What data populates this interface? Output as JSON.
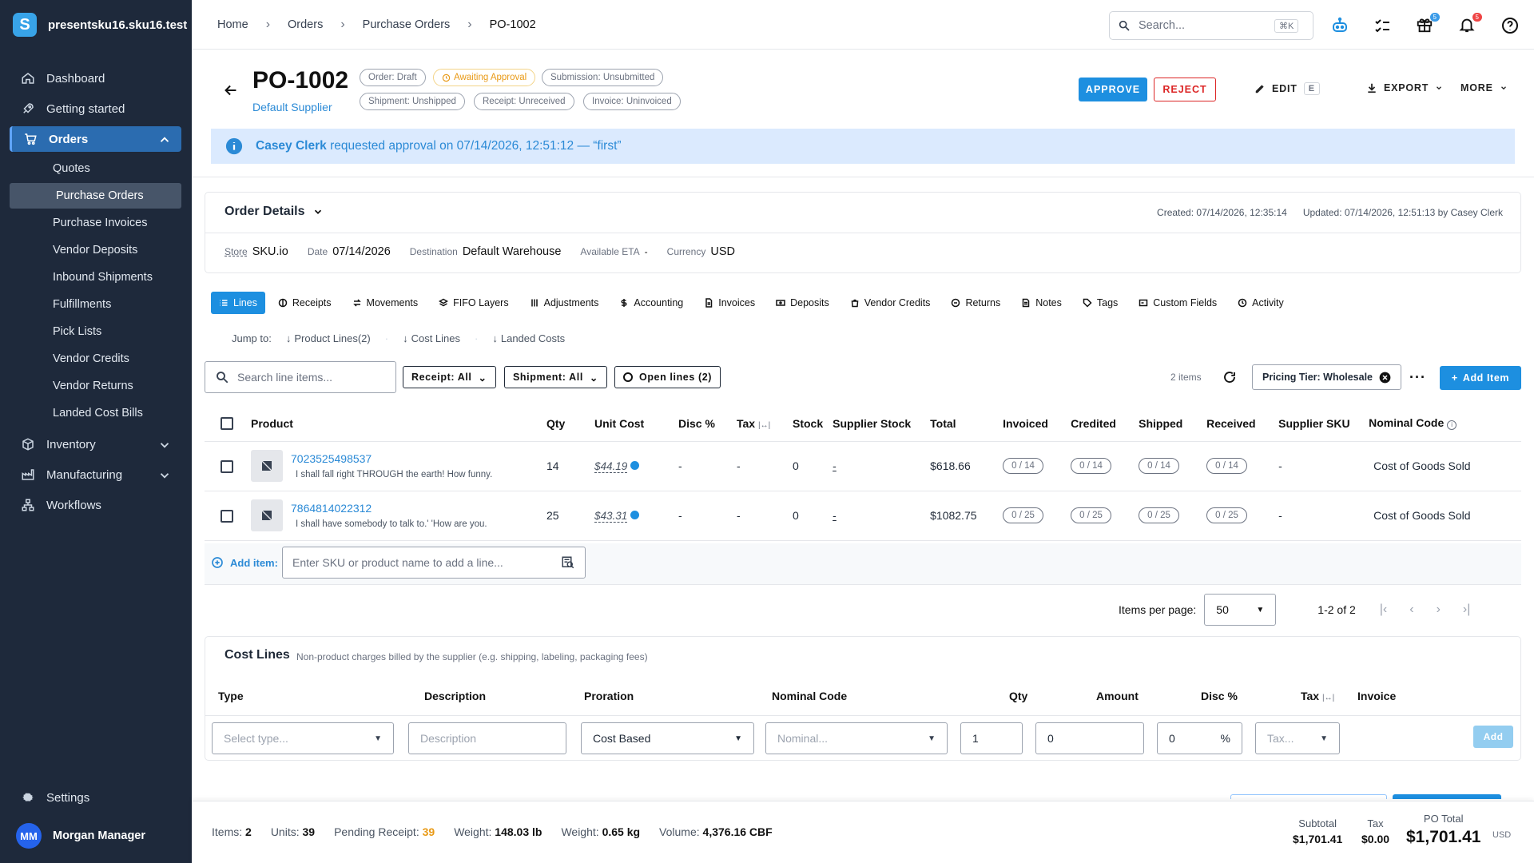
{
  "sidebar": {
    "brand": "presentsku16.sku16.test",
    "logo_letter": "S",
    "items": [
      {
        "label": "Dashboard"
      },
      {
        "label": "Getting started"
      },
      {
        "label": "Orders"
      },
      {
        "label": "Inventory"
      },
      {
        "label": "Manufacturing"
      },
      {
        "label": "Workflows"
      }
    ],
    "orders_sub": [
      "Quotes",
      "Purchase Orders",
      "Purchase Invoices",
      "Vendor Deposits",
      "Inbound Shipments",
      "Fulfillments",
      "Pick Lists",
      "Vendor Credits",
      "Vendor Returns",
      "Landed Cost Bills"
    ],
    "settings": "Settings",
    "user": {
      "initials": "MM",
      "name": "Morgan Manager"
    }
  },
  "topbar": {
    "breadcrumbs": [
      "Home",
      "Orders",
      "Purchase Orders",
      "PO-1002"
    ],
    "search_placeholder": "Search...",
    "search_kbd": "⌘K",
    "gift_badge": "5",
    "bell_badge": "5"
  },
  "header": {
    "title": "PO-1002",
    "supplier": "Default Supplier",
    "chips": {
      "order": "Order: Draft",
      "approval": "Awaiting Approval",
      "submission": "Submission: Unsubmitted",
      "shipment": "Shipment: Unshipped",
      "receipt": "Receipt: Unreceived",
      "invoice": "Invoice: Uninvoiced"
    },
    "approve": "APPROVE",
    "reject": "REJECT",
    "edit": "EDIT",
    "edit_kbd": "E",
    "export": "EXPORT",
    "more": "MORE"
  },
  "banner": {
    "user": "Casey Clerk",
    "text": "requested approval on 07/14/2026, 12:51:12 — “first”"
  },
  "details": {
    "title": "Order Details",
    "created": "Created: 07/14/2026, 12:35:14",
    "updated": "Updated: 07/14/2026, 12:51:13 by Casey Clerk",
    "fields": {
      "store_label": "Store",
      "store": "SKU.io",
      "date_label": "Date",
      "date": "07/14/2026",
      "dest_label": "Destination",
      "dest": "Default Warehouse",
      "eta_label": "Available ETA",
      "eta": "-",
      "currency_label": "Currency",
      "currency": "USD"
    }
  },
  "tabs": [
    "Lines",
    "Receipts",
    "Movements",
    "FIFO Layers",
    "Adjustments",
    "Accounting",
    "Invoices",
    "Deposits",
    "Vendor Credits",
    "Returns",
    "Notes",
    "Tags",
    "Custom Fields",
    "Activity"
  ],
  "jump": {
    "label": "Jump to:",
    "links": [
      "Product Lines(2)",
      "Cost Lines",
      "Landed Costs"
    ]
  },
  "filters": {
    "search_placeholder": "Search line items...",
    "receipt": "Receipt: All",
    "shipment": "Shipment: All",
    "open_lines": "Open lines (2)",
    "count": "2 items",
    "pricing": "Pricing Tier: Wholesale",
    "add_item": "Add Item"
  },
  "table": {
    "headers": [
      "Product",
      "Qty",
      "Unit Cost",
      "Disc %",
      "Tax",
      "Stock",
      "Supplier Stock",
      "Total",
      "Invoiced",
      "Credited",
      "Shipped",
      "Received",
      "Supplier SKU",
      "Nominal Code"
    ],
    "rows": [
      {
        "sku": "7023525498537",
        "desc": "I shall fall right THROUGH the earth! How funny.",
        "qty": "14",
        "unit_cost": "$44.19",
        "disc": "-",
        "tax": "-",
        "stock": "0",
        "supplier_stock": "-",
        "total": "$618.66",
        "invoiced": "0 / 14",
        "credited": "0 / 14",
        "shipped": "0 / 14",
        "received": "0 / 14",
        "supplier_sku": "-",
        "nominal": "Cost of Goods Sold"
      },
      {
        "sku": "7864814022312",
        "desc": "I shall have somebody to talk to.' 'How are you.",
        "qty": "25",
        "unit_cost": "$43.31",
        "disc": "-",
        "tax": "-",
        "stock": "0",
        "supplier_stock": "-",
        "total": "$1082.75",
        "invoiced": "0 / 25",
        "credited": "0 / 25",
        "shipped": "0 / 25",
        "received": "0 / 25",
        "supplier_sku": "-",
        "nominal": "Cost of Goods Sold"
      }
    ]
  },
  "add_row": {
    "label": "Add item:",
    "placeholder": "Enter SKU or product name to add a line..."
  },
  "pager": {
    "label": "Items per page:",
    "per_page": "50",
    "range": "1-2 of 2"
  },
  "cost_lines": {
    "title": "Cost Lines",
    "desc": "Non-product charges billed by the supplier (e.g. shipping, labeling, packaging fees)",
    "headers": {
      "type": "Type",
      "description": "Description",
      "proration": "Proration",
      "nominal": "Nominal Code",
      "qty": "Qty",
      "amount": "Amount",
      "disc": "Disc %",
      "tax": "Tax",
      "invoice": "Invoice"
    },
    "inputs": {
      "type": "Select type...",
      "description": "Description",
      "proration": "Cost Based",
      "nominal": "Nominal...",
      "qty": "1",
      "amount": "0",
      "disc": "0",
      "disc_unit": "%",
      "tax": "Tax..."
    },
    "add": "Add"
  },
  "footer": {
    "items_label": "Items:",
    "items": "2",
    "units_label": "Units:",
    "units": "39",
    "pending_label": "Pending Receipt:",
    "pending": "39",
    "weight1_label": "Weight:",
    "weight1": "148.03 lb",
    "weight2_label": "Weight:",
    "weight2": "0.65 kg",
    "volume_label": "Volume:",
    "volume": "4,376.16 CBF",
    "subtotal_label": "Subtotal",
    "subtotal": "$1,701.41",
    "tax_label": "Tax",
    "tax": "$0.00",
    "total_label": "PO Total",
    "total": "$1,701.41",
    "currency": "USD"
  }
}
